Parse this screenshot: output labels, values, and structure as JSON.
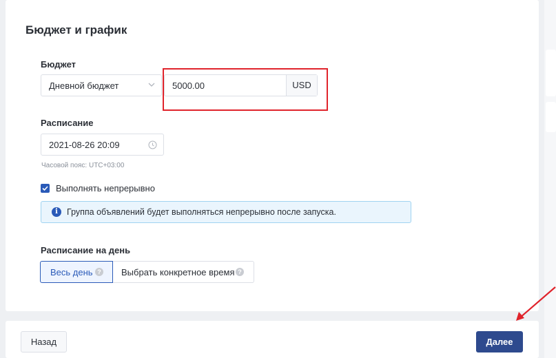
{
  "section": {
    "title": "Бюджет и график"
  },
  "budget": {
    "label": "Бюджет",
    "type_selected": "Дневной бюджет",
    "amount": "5000.00",
    "currency": "USD"
  },
  "schedule": {
    "label": "Расписание",
    "start_datetime": "2021-08-26 20:09",
    "timezone_hint": "Часовой пояс: UTC+03:00",
    "continuous_label": "Выполнять непрерывно",
    "continuous_checked": true,
    "notice": "Группа объявлений будет выполняться непрерывно после запуска."
  },
  "day_schedule": {
    "label": "Расписание на день",
    "options": [
      {
        "label": "Весь день",
        "active": true
      },
      {
        "label": "Выбрать конкретное время",
        "active": false
      }
    ]
  },
  "footer": {
    "back_label": "Назад",
    "next_label": "Далее"
  },
  "colors": {
    "primary": "#2e4a8e",
    "accent": "#2a5ab8",
    "annotation_red": "#e0232b",
    "notice_bg": "#eaf5fd"
  },
  "icons": [
    "chevron-down-icon",
    "clock-icon",
    "check-icon",
    "info-icon",
    "help-icon",
    "arrow-annotation-icon"
  ]
}
